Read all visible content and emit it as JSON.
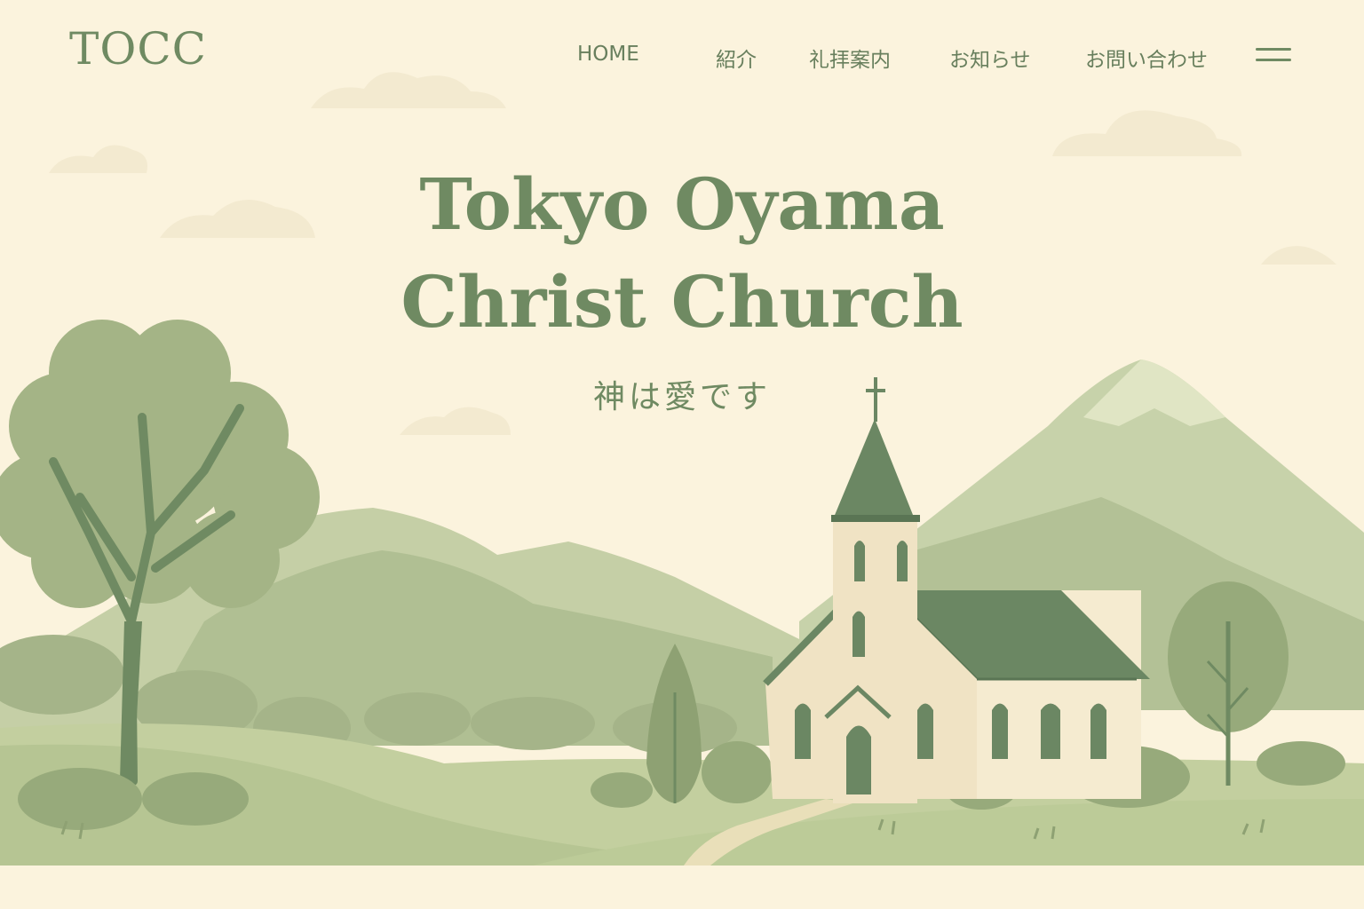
{
  "header": {
    "logo": "TOCC",
    "nav": [
      {
        "label": "HOME"
      },
      {
        "label": "紹介"
      },
      {
        "label": "礼拝案内"
      },
      {
        "label": "お知らせ"
      },
      {
        "label": "お問い合わせ"
      }
    ],
    "menu_icon": "hamburger-menu-icon"
  },
  "hero": {
    "title_line1": "Tokyo Oyama",
    "title_line2": "Christ Church",
    "subtitle": "神は愛です"
  },
  "colors": {
    "background": "#fbf3dd",
    "primary_green": "#6f8a62",
    "light_green": "#a9bb91",
    "pale_green": "#cbd4aa",
    "church_wall": "#f5ebd0",
    "church_roof": "#6b8763"
  }
}
